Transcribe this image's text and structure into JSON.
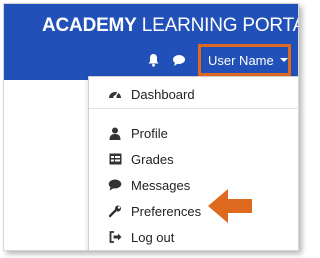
{
  "header": {
    "brand_bold": "ACADEMY",
    "brand_light": "LEARNING PORTAL",
    "icons": [
      "bell-icon",
      "chat-icon"
    ],
    "user_menu_label": "User Name",
    "highlight_color": "#dd6a1e",
    "navbar_color": "#2150b8"
  },
  "menu": {
    "items": [
      {
        "label": "Dashboard",
        "icon": "dashboard-icon"
      },
      {
        "label": "Profile",
        "icon": "user-icon"
      },
      {
        "label": "Grades",
        "icon": "table-icon"
      },
      {
        "label": "Messages",
        "icon": "comment-icon"
      },
      {
        "label": "Preferences",
        "icon": "wrench-icon"
      },
      {
        "label": "Log out",
        "icon": "sign-out-icon"
      }
    ]
  },
  "annotation": {
    "arrow_color": "#dd6a1e",
    "points_to": "Preferences"
  }
}
